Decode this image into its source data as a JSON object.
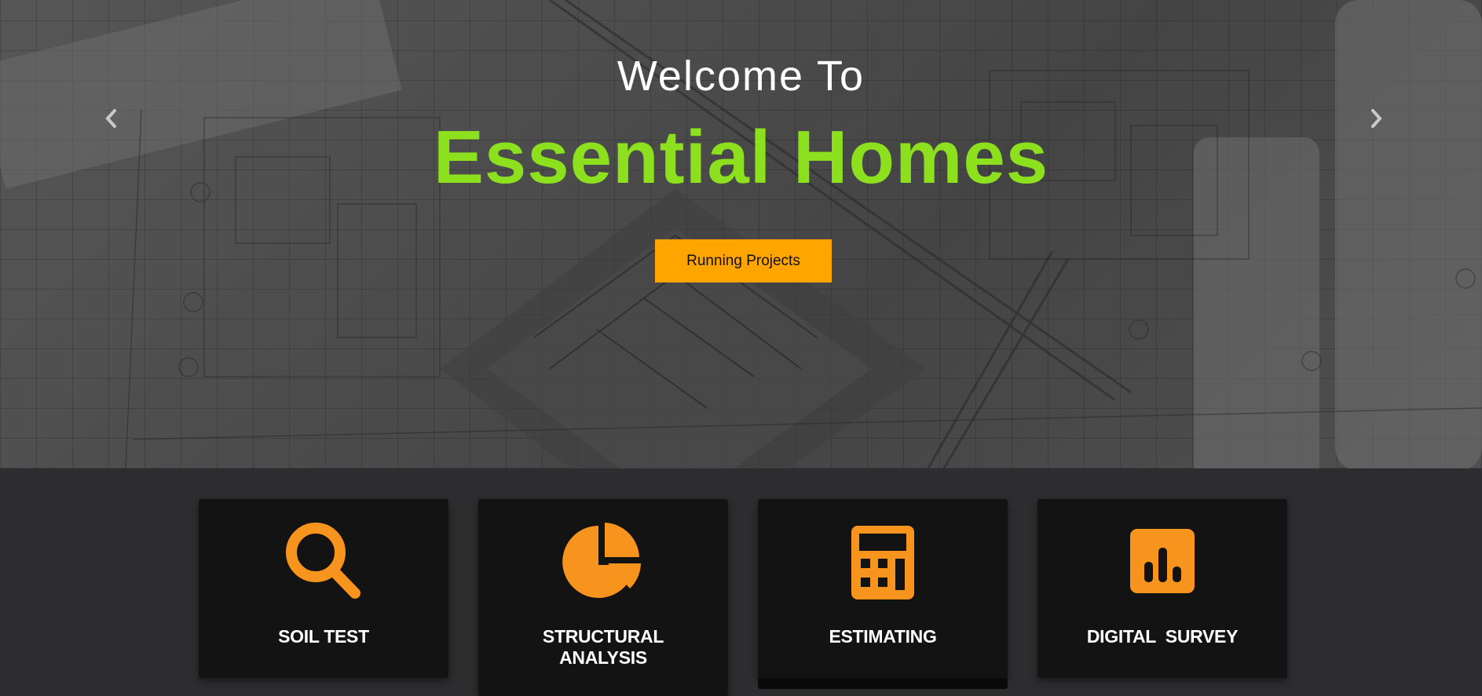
{
  "hero": {
    "welcome": "Welcome To",
    "brand": "Essential Homes",
    "cta_label": "Running Projects",
    "prev_icon": "chevron-left-icon",
    "next_icon": "chevron-right-icon"
  },
  "services": [
    {
      "title_line1": "SOIL TEST",
      "title_line2": "",
      "icon": "search-icon"
    },
    {
      "title_line1": "STRUCTURAL",
      "title_line2": "ANALYSIS",
      "icon": "pie-chart-icon"
    },
    {
      "title_line1": "ESTIMATING",
      "title_line2": "",
      "icon": "calculator-icon"
    },
    {
      "title_line1": "DIGITAL  SURVEY",
      "title_line2": "",
      "icon": "bar-chart-icon"
    }
  ],
  "colors": {
    "accent_green": "#8de01e",
    "accent_orange": "#ffa500",
    "icon_orange": "#f7941d",
    "card_bg": "#131313",
    "page_bg": "#2d2d2f"
  }
}
